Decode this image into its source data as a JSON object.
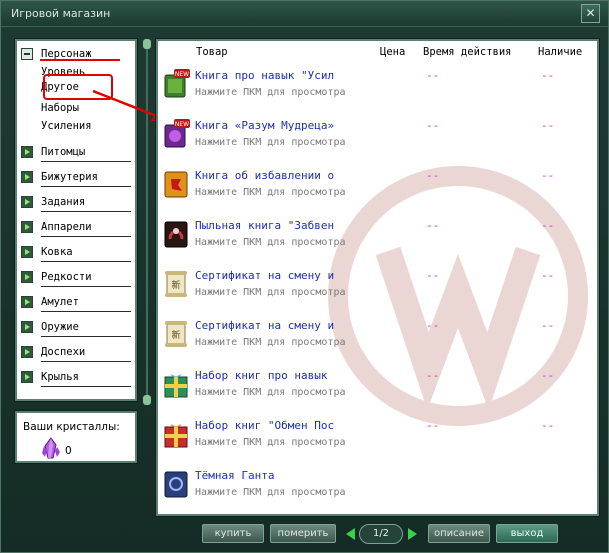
{
  "window": {
    "title": "Игровой магазин",
    "close_label": "✕"
  },
  "categories": {
    "expanded": {
      "label": "Персонаж",
      "children": [
        "Уровень",
        "Другое",
        "Наборы",
        "Усиления"
      ]
    },
    "collapsed": [
      "Питомцы",
      "Бижутерия",
      "Задания",
      "Аппарели",
      "Ковка",
      "Редкости",
      "Амулет",
      "Оружие",
      "Доспехи",
      "Крылья"
    ]
  },
  "crystals": {
    "label": "Ваши кристаллы:",
    "count": "0"
  },
  "table": {
    "headers": {
      "item": "Товар",
      "price": "Цена",
      "duration": "Время действия",
      "availability": "Наличие"
    }
  },
  "items": [
    {
      "name": "Книга про навык \"Усил",
      "sub": "Нажмите ПКМ для просмотра",
      "duration": "--",
      "availability": "--",
      "icon": "book-green-new-icon"
    },
    {
      "name": "Книга «Разум Мудреца»",
      "sub": "Нажмите ПКМ для просмотра",
      "duration": "--",
      "availability": "--",
      "icon": "book-purple-new-icon"
    },
    {
      "name": "Книга об избавлении о",
      "sub": "Нажмите ПКМ для просмотра",
      "duration": "--",
      "availability": "--",
      "icon": "book-orange-icon"
    },
    {
      "name": "Пыльная книга \"Забвен",
      "sub": "Нажмите ПКМ для просмотра",
      "duration": "--",
      "availability": "--",
      "icon": "book-dark-icon"
    },
    {
      "name": "Сертификат на смену и",
      "sub": "Нажмите ПКМ для просмотра",
      "duration": "--",
      "availability": "--",
      "icon": "scroll-icon"
    },
    {
      "name": "Сертификат на смену и",
      "sub": "Нажмите ПКМ для просмотра",
      "duration": "--",
      "availability": "--",
      "icon": "scroll-icon"
    },
    {
      "name": "Набор книг про навык",
      "sub": "Нажмите ПКМ для просмотра",
      "duration": "--",
      "availability": "--",
      "icon": "gift-green-icon"
    },
    {
      "name": "Набор книг \"Обмен Пос",
      "sub": "Нажмите ПКМ для просмотра",
      "duration": "--",
      "availability": "--",
      "icon": "gift-red-icon"
    },
    {
      "name": "Тёмная Ганта",
      "sub": "Нажмите ПКМ для просмотра",
      "duration": "",
      "availability": "",
      "icon": "book-blue-icon"
    }
  ],
  "toolbar": {
    "buy_label": "купить",
    "try_label": "померить",
    "page": "1/2",
    "description_label": "описание",
    "exit_label": "выход"
  },
  "colors": {
    "accent_green": "#39d14a",
    "item_name": "#1d2fb5",
    "dash": "#d22fd2",
    "highlight_red": "#e00000"
  }
}
